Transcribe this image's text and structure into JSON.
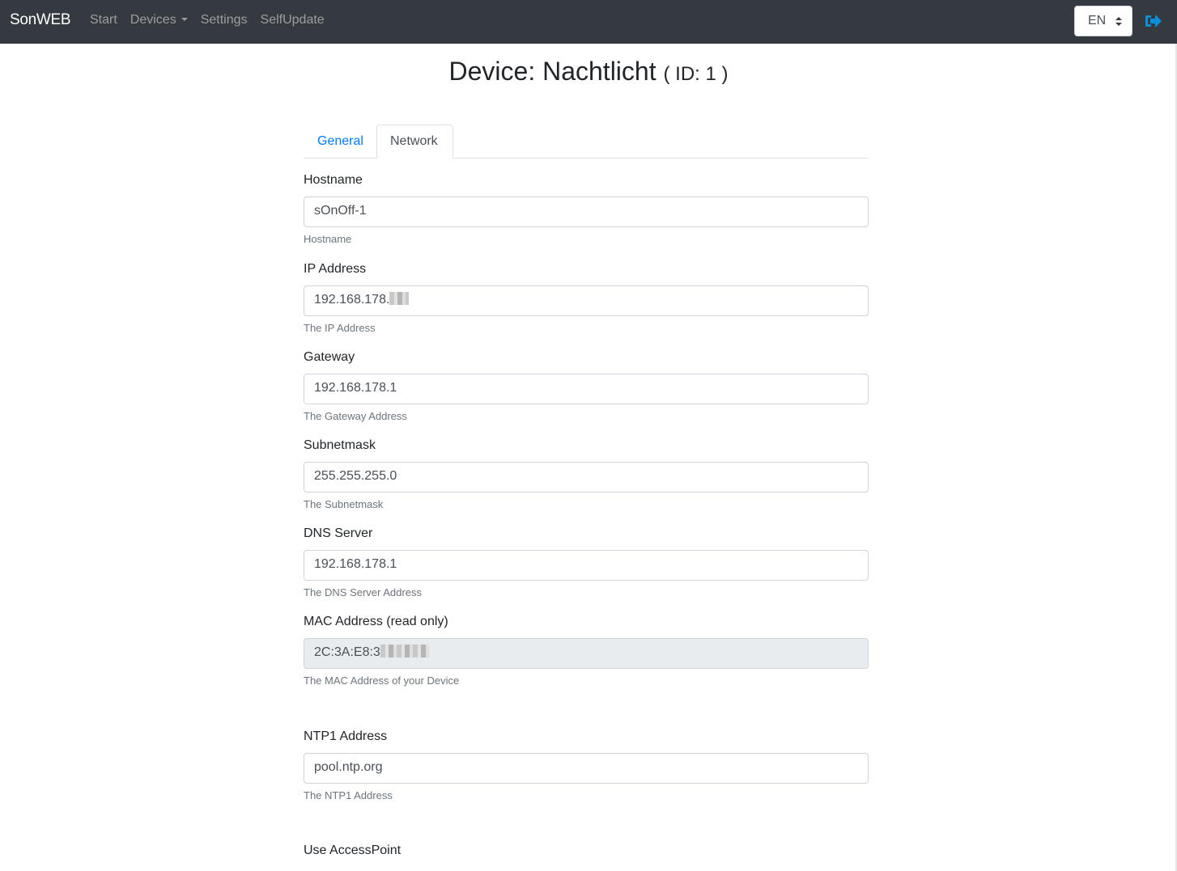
{
  "navbar": {
    "brand": "SonWEB",
    "links": [
      {
        "label": "Start"
      },
      {
        "label": "Devices",
        "dropdown": true
      },
      {
        "label": "Settings"
      },
      {
        "label": "SelfUpdate"
      }
    ],
    "language": "EN",
    "logout_icon": "sign-out-icon",
    "accent_color": "#0a90d8"
  },
  "page": {
    "title": "Device: Nachtlicht",
    "id_label": "( ID: 1 )"
  },
  "tabs": [
    {
      "label": "General",
      "active": false
    },
    {
      "label": "Network",
      "active": true
    }
  ],
  "fields": {
    "hostname": {
      "label": "Hostname",
      "value": "sOnOff-1",
      "help": "Hostname"
    },
    "ip": {
      "label": "IP Address",
      "value": "192.168.178.",
      "help": "The IP Address"
    },
    "gateway": {
      "label": "Gateway",
      "value": "192.168.178.1",
      "help": "The Gateway Address"
    },
    "subnet": {
      "label": "Subnetmask",
      "value": "255.255.255.0",
      "help": "The Subnetmask"
    },
    "dns": {
      "label": "DNS Server",
      "value": "192.168.178.1",
      "help": "The DNS Server Address"
    },
    "mac": {
      "label": "MAC Address (read only)",
      "value": "2C:3A:E8:3",
      "help": "The MAC Address of your Device",
      "readonly": true
    },
    "ntp1": {
      "label": "NTP1 Address",
      "value": "pool.ntp.org",
      "help": "The NTP1 Address"
    },
    "accesspoint": {
      "label": "Use AccessPoint"
    }
  }
}
